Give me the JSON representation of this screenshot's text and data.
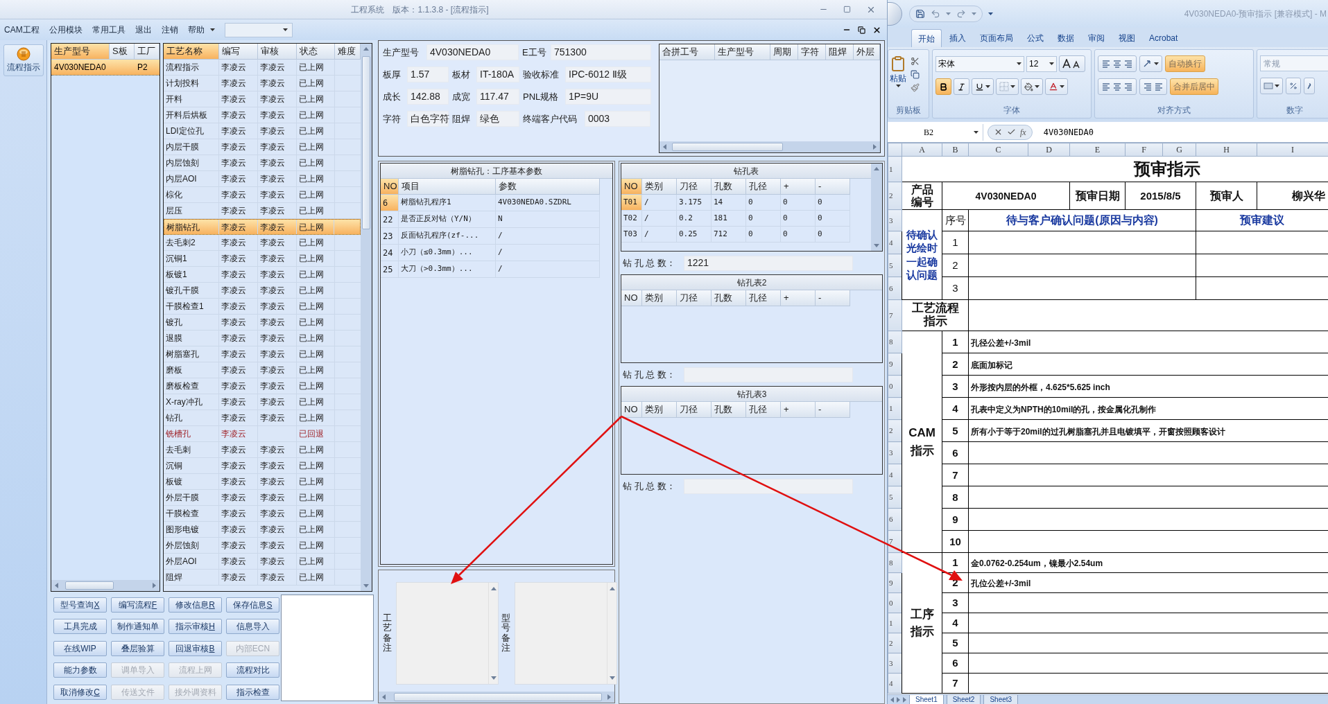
{
  "app": {
    "title": "工程系统",
    "subtitle": "版本：1.1.3.8 - [流程指示]",
    "menu": [
      {
        "label": "CAM工程",
        "dropdown": false
      },
      {
        "label": "公用模块",
        "dropdown": false
      },
      {
        "label": "常用工具",
        "dropdown": false
      },
      {
        "label": "退出",
        "dropdown": false
      },
      {
        "label": "注销",
        "dropdown": false
      },
      {
        "label": "帮助",
        "dropdown": true
      }
    ],
    "nav": [
      {
        "label": "流程指示",
        "selected": true
      }
    ],
    "models": {
      "columns": [
        "生产型号",
        "S板",
        "工厂"
      ],
      "rows": [
        {
          "model": "4V030NEDA0",
          "factory": "P2",
          "selected": true
        }
      ]
    },
    "processes": {
      "columns": [
        "工艺名称",
        "编写",
        "审核",
        "状态",
        "难度"
      ],
      "rows": [
        {
          "name": "流程指示",
          "writer": "李凌云",
          "reviewer": "李凌云",
          "status": "已上网",
          "selected": false,
          "returned": false
        },
        {
          "name": "计划投料",
          "writer": "李凌云",
          "reviewer": "李凌云",
          "status": "已上网",
          "selected": false,
          "returned": false
        },
        {
          "name": "开料",
          "writer": "李凌云",
          "reviewer": "李凌云",
          "status": "已上网",
          "selected": false,
          "returned": false
        },
        {
          "name": "开料后烘板",
          "writer": "李凌云",
          "reviewer": "李凌云",
          "status": "已上网",
          "selected": false,
          "returned": false
        },
        {
          "name": "LDI定位孔",
          "writer": "李凌云",
          "reviewer": "李凌云",
          "status": "已上网",
          "selected": false,
          "returned": false
        },
        {
          "name": "内层干膜",
          "writer": "李凌云",
          "reviewer": "李凌云",
          "status": "已上网",
          "selected": false,
          "returned": false
        },
        {
          "name": "内层蚀刻",
          "writer": "李凌云",
          "reviewer": "李凌云",
          "status": "已上网",
          "selected": false,
          "returned": false
        },
        {
          "name": "内层AOI",
          "writer": "李凌云",
          "reviewer": "李凌云",
          "status": "已上网",
          "selected": false,
          "returned": false
        },
        {
          "name": "棕化",
          "writer": "李凌云",
          "reviewer": "李凌云",
          "status": "已上网",
          "selected": false,
          "returned": false
        },
        {
          "name": "层压",
          "writer": "李凌云",
          "reviewer": "李凌云",
          "status": "已上网",
          "selected": false,
          "returned": false
        },
        {
          "name": "树脂钻孔",
          "writer": "李凌云",
          "reviewer": "李凌云",
          "status": "已上网",
          "selected": true,
          "returned": false
        },
        {
          "name": "去毛刺2",
          "writer": "李凌云",
          "reviewer": "李凌云",
          "status": "已上网",
          "selected": false,
          "returned": false
        },
        {
          "name": "沉铜1",
          "writer": "李凌云",
          "reviewer": "李凌云",
          "status": "已上网",
          "selected": false,
          "returned": false
        },
        {
          "name": "板镀1",
          "writer": "李凌云",
          "reviewer": "李凌云",
          "status": "已上网",
          "selected": false,
          "returned": false
        },
        {
          "name": "镀孔干膜",
          "writer": "李凌云",
          "reviewer": "李凌云",
          "status": "已上网",
          "selected": false,
          "returned": false
        },
        {
          "name": "干膜检查1",
          "writer": "李凌云",
          "reviewer": "李凌云",
          "status": "已上网",
          "selected": false,
          "returned": false
        },
        {
          "name": "镀孔",
          "writer": "李凌云",
          "reviewer": "李凌云",
          "status": "已上网",
          "selected": false,
          "returned": false
        },
        {
          "name": "退膜",
          "writer": "李凌云",
          "reviewer": "李凌云",
          "status": "已上网",
          "selected": false,
          "returned": false
        },
        {
          "name": "树脂塞孔",
          "writer": "李凌云",
          "reviewer": "李凌云",
          "status": "已上网",
          "selected": false,
          "returned": false
        },
        {
          "name": "磨板",
          "writer": "李凌云",
          "reviewer": "李凌云",
          "status": "已上网",
          "selected": false,
          "returned": false
        },
        {
          "name": "磨板检查",
          "writer": "李凌云",
          "reviewer": "李凌云",
          "status": "已上网",
          "selected": false,
          "returned": false
        },
        {
          "name": "X-ray冲孔",
          "writer": "李凌云",
          "reviewer": "李凌云",
          "status": "已上网",
          "selected": false,
          "returned": false
        },
        {
          "name": "钻孔",
          "writer": "李凌云",
          "reviewer": "李凌云",
          "status": "已上网",
          "selected": false,
          "returned": false
        },
        {
          "name": "铣槽孔",
          "writer": "李凌云",
          "status": "已回退",
          "selected": false,
          "returned": true
        },
        {
          "name": "去毛刺",
          "writer": "李凌云",
          "reviewer": "李凌云",
          "status": "已上网",
          "selected": false,
          "returned": false
        },
        {
          "name": "沉铜",
          "writer": "李凌云",
          "reviewer": "李凌云",
          "status": "已上网",
          "selected": false,
          "returned": false
        },
        {
          "name": "板镀",
          "writer": "李凌云",
          "reviewer": "李凌云",
          "status": "已上网",
          "selected": false,
          "returned": false
        },
        {
          "name": "外层干膜",
          "writer": "李凌云",
          "reviewer": "李凌云",
          "status": "已上网",
          "selected": false,
          "returned": false
        },
        {
          "name": "干膜检查",
          "writer": "李凌云",
          "reviewer": "李凌云",
          "status": "已上网",
          "selected": false,
          "returned": false
        },
        {
          "name": "图形电镀",
          "writer": "李凌云",
          "reviewer": "李凌云",
          "status": "已上网",
          "selected": false,
          "returned": false
        },
        {
          "name": "外层蚀刻",
          "writer": "李凌云",
          "reviewer": "李凌云",
          "status": "已上网",
          "selected": false,
          "returned": false
        },
        {
          "name": "外层AOI",
          "writer": "李凌云",
          "reviewer": "李凌云",
          "status": "已上网",
          "selected": false,
          "returned": false
        },
        {
          "name": "阻焊",
          "writer": "李凌云",
          "reviewer": "李凌云",
          "status": "已上网",
          "selected": false,
          "returned": false
        }
      ]
    },
    "buttons": [
      {
        "label": "型号查询",
        "key": "X",
        "disabled": false
      },
      {
        "label": "编写流程",
        "key": "F",
        "disabled": false
      },
      {
        "label": "修改信息",
        "key": "R",
        "disabled": false
      },
      {
        "label": "保存信息",
        "key": "S",
        "disabled": false
      },
      {
        "label": "工具完成",
        "disabled": false
      },
      {
        "label": "制作通知单",
        "disabled": false
      },
      {
        "label": "指示审核",
        "key": "H",
        "disabled": false
      },
      {
        "label": "信息导入",
        "disabled": false
      },
      {
        "label": "在线WIP",
        "disabled": false
      },
      {
        "label": "叠层验算",
        "disabled": false
      },
      {
        "label": "回退审核",
        "key": "B",
        "disabled": false
      },
      {
        "label": "内部ECN",
        "disabled": true
      },
      {
        "label": "能力参数",
        "disabled": false
      },
      {
        "label": "调单导入",
        "disabled": true
      },
      {
        "label": "流程上网",
        "disabled": true
      },
      {
        "label": "流程对比",
        "disabled": false
      },
      {
        "label": "取消修改",
        "key": "C",
        "disabled": false
      },
      {
        "label": "传送文件",
        "disabled": true
      },
      {
        "label": "接外调资料",
        "disabled": true
      },
      {
        "label": "指示检查",
        "disabled": false
      }
    ],
    "info": [
      [
        {
          "label": "生产型号",
          "value": "4V030NEDA0"
        },
        {
          "label": "E工号",
          "value": "751300"
        }
      ],
      [
        {
          "label": "板厚",
          "value": "1.57"
        },
        {
          "label": "板材",
          "value": "IT-180A"
        },
        {
          "label": "验收标准",
          "value": "IPC-6012 Ⅱ级"
        }
      ],
      [
        {
          "label": "成长",
          "value": "142.88"
        },
        {
          "label": "成宽",
          "value": "117.47"
        },
        {
          "label": "PNL规格",
          "value": "1P=9U"
        }
      ],
      [
        {
          "label": "字符",
          "value": "白色字符"
        },
        {
          "label": "阻焊",
          "value": "绿色"
        },
        {
          "label": "终端客户代码",
          "value": "0003"
        }
      ]
    ],
    "merge_grid": {
      "columns": [
        "合拼工号",
        "生产型号",
        "周期",
        "字符",
        "阻焊",
        "外层"
      ]
    },
    "params": {
      "title": "树脂钻孔：工序基本参数",
      "columns": [
        "NO",
        "项目",
        "参数"
      ],
      "rows": [
        {
          "no": "6",
          "item": "树脂钻孔程序1",
          "value": "4V030NEDA0.SZDRL",
          "selected": true
        },
        {
          "no": "22",
          "item": "是否正反对钻（Y/N）",
          "value": "N",
          "selected": false
        },
        {
          "no": "23",
          "item": "反面钻孔程序(zf-...",
          "value": "/",
          "selected": false
        },
        {
          "no": "24",
          "item": "小刀（≤0.3mm）...",
          "value": "/",
          "selected": false
        },
        {
          "no": "25",
          "item": "大刀（>0.3mm）...",
          "value": "/",
          "selected": false
        }
      ]
    },
    "drill_tables": [
      {
        "title": "钻孔表",
        "columns": [
          "NO",
          "类别",
          "刀径",
          "孔数",
          "孔径",
          "+",
          "-"
        ],
        "rows": [
          {
            "cells": [
              "T01",
              "/",
              "3.175",
              "14",
              "0",
              "0",
              "0"
            ],
            "selected": true
          },
          {
            "cells": [
              "T02",
              "/",
              "0.2",
              "181",
              "0",
              "0",
              "0"
            ],
            "selected": false
          },
          {
            "cells": [
              "T03",
              "/",
              "0.25",
              "712",
              "0",
              "0",
              "0"
            ],
            "selected": false
          }
        ],
        "total_label": "钻 孔 总 数：",
        "total": "1221"
      },
      {
        "title": "钻孔表2",
        "columns": [
          "NO",
          "类别",
          "刀径",
          "孔数",
          "孔径",
          "+",
          "-"
        ],
        "total_label": "钻 孔 总 数："
      },
      {
        "title": "钻孔表3",
        "columns": [
          "NO",
          "类别",
          "刀径",
          "孔数",
          "孔径",
          "+",
          "-"
        ],
        "total_label": "钻 孔 总 数："
      }
    ],
    "remarks": [
      {
        "label": "工艺备注"
      },
      {
        "label": "型号备注"
      }
    ]
  },
  "excel": {
    "title": "4V030NEDA0-预审指示  [兼容模式] - M",
    "tabs": [
      {
        "label": "开始",
        "selected": true
      },
      {
        "label": "插入",
        "selected": false
      },
      {
        "label": "页面布局",
        "selected": false
      },
      {
        "label": "公式",
        "selected": false
      },
      {
        "label": "数据",
        "selected": false
      },
      {
        "label": "审阅",
        "selected": false
      },
      {
        "label": "视图",
        "selected": false
      },
      {
        "label": "Acrobat",
        "selected": false
      }
    ],
    "paste": "粘贴",
    "font": "宋体",
    "font_size": "12",
    "format": {
      "bold": true,
      "italic": false,
      "underline": false
    },
    "wrap_text": {
      "label": "自动换行",
      "on": true
    },
    "merge_center": {
      "label": "合并后居中",
      "on": true
    },
    "number_format": "常规",
    "groups": [
      "剪贴板",
      "字体",
      "对齐方式",
      "数字"
    ],
    "name_box": "B2",
    "fx": "fx",
    "formula": "4V030NEDA0",
    "columns": [
      "A",
      "B",
      "C",
      "D",
      "E",
      "F",
      "G",
      "H",
      "I"
    ],
    "row_numbers": [
      "1",
      "2",
      "3",
      "4",
      "5",
      "6",
      "7",
      "8",
      "9",
      "0",
      "1",
      "2",
      "3",
      "4",
      "5",
      "6",
      "7",
      "8",
      "9",
      "0",
      "1",
      "2",
      "3",
      "4"
    ],
    "sheet": {
      "title": "预审指示",
      "product_label": "产品编号",
      "product": "4V030NEDA0",
      "date_label": "预审日期",
      "date": "2015/8/5",
      "reviewer_label": "预审人",
      "reviewer": "柳兴华",
      "confirm_label": "待确认光绘时一起确认问题",
      "no_header": "序号",
      "issue_header": "待与客户确认问题(原因与内容)",
      "advice_header": "预审建议",
      "confirm_rows": [
        "1",
        "2",
        "3"
      ],
      "flow_label": "工艺流程指示",
      "sections": [
        {
          "label": "CAM指示",
          "items": [
            {
              "no": "1",
              "text": "孔径公差+/-3mil"
            },
            {
              "no": "2",
              "text": "底面加标记"
            },
            {
              "no": "3",
              "text": "外形按内层的外框，4.625*5.625 inch"
            },
            {
              "no": "4",
              "text": "孔表中定义为NPTH的10mil的孔，按金属化孔制作"
            },
            {
              "no": "5",
              "text": "所有小于等于20mil的过孔树脂塞孔并且电镀填平，开窗按照顾客设计"
            },
            {
              "no": "6"
            },
            {
              "no": "7"
            },
            {
              "no": "8"
            },
            {
              "no": "9"
            },
            {
              "no": "10"
            }
          ]
        },
        {
          "label": "工序指示",
          "items": [
            {
              "no": "1",
              "text": "金0.0762-0.254um，镍最小2.54um"
            },
            {
              "no": "2",
              "text": "孔位公差+/-3mil"
            },
            {
              "no": "3"
            },
            {
              "no": "4"
            },
            {
              "no": "5"
            },
            {
              "no": "6"
            },
            {
              "no": "7"
            }
          ]
        }
      ]
    },
    "sheet_tabs": [
      {
        "label": "Sheet1",
        "selected": true
      },
      {
        "label": "Sheet2",
        "selected": false
      },
      {
        "label": "Sheet3",
        "selected": false
      }
    ]
  }
}
